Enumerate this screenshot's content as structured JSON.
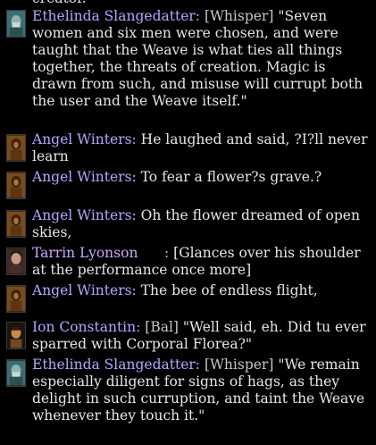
{
  "top_partial": "creator.",
  "messages": [
    {
      "speaker": "Ethelinda Slangedatter:",
      "tag": "[Whisper]",
      "text": " \"Seven women and six men were chosen, and were taught that the Weave is what ties all things together, the threats of creation. Magic is drawn from such, and misuse will currupt both the user and the Weave itself.\"",
      "avatar": "ethelinda-portrait"
    },
    {
      "speaker": "Angel Winters:",
      "text": " He laughed and said, ?I?ll never learn",
      "avatar": "angel-portrait"
    },
    {
      "speaker": "Angel Winters:",
      "text": " To fear a flower?s grave.?",
      "avatar": "angel-portrait"
    },
    {
      "speaker": "Angel Winters:",
      "text": " Oh the flower dreamed of open skies,",
      "avatar": "angel-portrait"
    },
    {
      "speaker": "Tarrin Lyonson      :",
      "text": " [Glances over his shoulder at the performance once more]",
      "avatar": "tarrin-portrait"
    },
    {
      "speaker": "Angel Winters:",
      "text": " The bee of endless flight,",
      "avatar": "angel-portrait"
    },
    {
      "speaker": "Ion Constantin:",
      "tag": "[Bal]",
      "text": " \"Well said, eh. Did tu ever sparred with Corporal Florea?\"",
      "avatar": "ion-portrait"
    },
    {
      "speaker": "Ethelinda Slangedatter:",
      "tag": "[Whisper]",
      "text": " \"We remain especially diligent for signs of hags, as they delight in such curruption, and taint the Weave whenever they touch it.\"",
      "avatar": "ethelinda-portrait"
    }
  ],
  "colors": {
    "background": "#000000",
    "speaker": "#b0a8ff",
    "tag": "#c8c8c8",
    "text": "#ffffff"
  }
}
